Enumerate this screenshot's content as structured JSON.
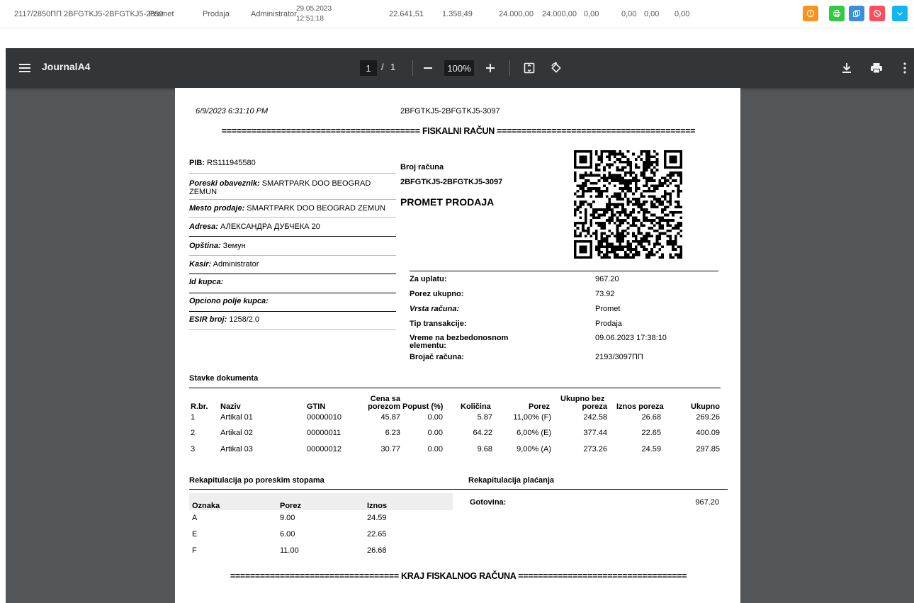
{
  "list_row": {
    "number": "2117/2850ПП",
    "receipt_id": "2BFGTKJ5-2BFGTKJ5-2850",
    "invoice_type": "Promet",
    "transaction_type": "Prodaja",
    "cashier": "Administrator",
    "date": "29.05.2023",
    "time": "12:51:18",
    "amounts": [
      "22.641,51",
      "1.358,49",
      "24.000,00",
      "24.000,00",
      "0,00",
      "0,00",
      "0,00",
      "0,00"
    ],
    "actions": [
      {
        "name": "info-button",
        "color": "#f7931e",
        "icon": "info-icon"
      },
      {
        "name": "print-button",
        "color": "#2ecc40",
        "icon": "print-icon"
      },
      {
        "name": "copy-button",
        "color": "#3c8dde",
        "icon": "copy-icon"
      },
      {
        "name": "cancel-button",
        "color": "#ff4d5a",
        "icon": "block-icon"
      },
      {
        "name": "expand-button",
        "color": "#12b4f2",
        "icon": "chevron-down-icon"
      }
    ]
  },
  "viewer": {
    "title": "JournalA4",
    "page_current": "1",
    "page_sep": "/",
    "page_total": "1",
    "zoom": "100%"
  },
  "receipt": {
    "printed_at": "6/9/2023 6:31:10 PM",
    "header_id": "2BFGTKJ5-2BFGTKJ5-3097",
    "title_line": "======================================== FISKALNI RAČUN ========================================",
    "left_fields": [
      {
        "label": "PIB:",
        "value": " RS111945580"
      },
      {
        "label": "Poreski obaveznik:",
        "value": " SMARTPARK DOO BEOGRAD",
        "value2": "ZEMUN"
      },
      {
        "label": "Mesto prodaje:",
        "value": " SMARTPARK DOO BEOGRAD ZEMUN"
      },
      {
        "label": "Adresa:",
        "value": " АЛЕКСАНДРА ДУБЧЕКА 20"
      },
      {
        "label": "Opština:",
        "value": " Земун"
      },
      {
        "label": "Kasir:",
        "value": " Administrator"
      },
      {
        "label": "Id kupca:",
        "value": ""
      },
      {
        "label": "Opciono polje kupca:",
        "value": ""
      },
      {
        "label": "ESIR broj:",
        "value": " 1258/2.0"
      }
    ],
    "broj_racuna_label": "Broj računa",
    "broj_racuna": "2BFGTKJ5-2BFGTKJ5-3097",
    "promet_title": "PROMET PRODAJA",
    "summary": [
      {
        "label": "Za uplatu:",
        "value": "967.20"
      },
      {
        "label": "Porez ukupno:",
        "value": "73.92"
      },
      {
        "label": "Vrsta računa:",
        "value": "Promet"
      },
      {
        "label": "Tip transakcije:",
        "value": "Prodaja"
      },
      {
        "label": "Vreme na bezbedonosnom",
        "label2": "elementu:",
        "value": "09.06.2023 17:38:10"
      },
      {
        "label": "Brojač računa:",
        "value": "2193/3097ПП"
      }
    ],
    "items_title": "Stavke dokumenta",
    "items_headers": [
      "R.br.",
      "Naziv",
      "GTIN",
      "Cena sa",
      "porezom",
      "Popust (%)",
      "Količina",
      "Porez",
      "Ukupno bez",
      "poreza",
      "Iznos poreza",
      "Ukupno"
    ],
    "items": [
      [
        "1",
        "Artikal 01",
        "00000010",
        "45.87",
        "0.00",
        "5.87",
        "11,00% (F)",
        "242.58",
        "26.68",
        "269.26"
      ],
      [
        "2",
        "Artikal 02",
        "00000011",
        "6.23",
        "0.00",
        "64.22",
        "6,00% (E)",
        "377.44",
        "22.65",
        "400.09"
      ],
      [
        "3",
        "Artikal 03",
        "00000012",
        "30.77",
        "0.00",
        "9.68",
        "9,00% (A)",
        "273.26",
        "24.59",
        "297.85"
      ]
    ],
    "tax_recap_title": "Rekapitulacija po poreskim stopama",
    "tax_recap_headers": [
      "Oznaka",
      "Porez",
      "Iznos"
    ],
    "tax_recap": [
      [
        "A",
        "9.00",
        "24.59"
      ],
      [
        "E",
        "6.00",
        "22.65"
      ],
      [
        "F",
        "11.00",
        "26.68"
      ]
    ],
    "payment_recap_title": "Rekapitulacija plaćanja",
    "payments": [
      {
        "label": "Gotovina:",
        "value": "967.20"
      }
    ],
    "end_line": "================================== KRAJ FISKALNOG RAČUNA =================================="
  }
}
